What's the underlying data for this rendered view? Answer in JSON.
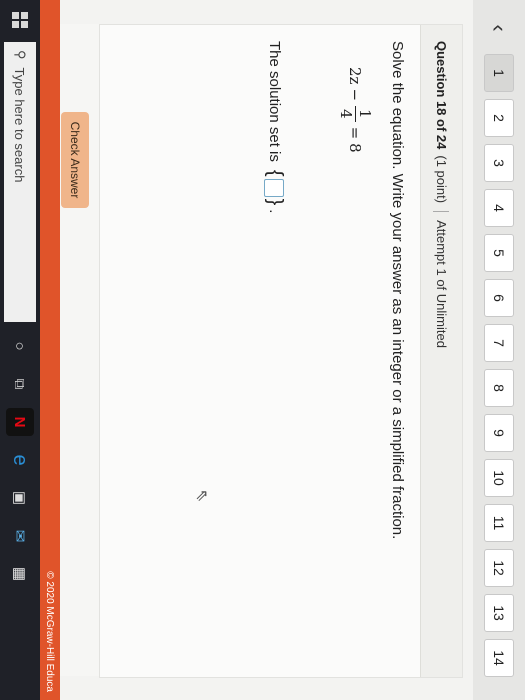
{
  "nav": {
    "back_glyph": "‹",
    "questions": [
      "1",
      "2",
      "3",
      "4",
      "5",
      "6",
      "7",
      "8",
      "9",
      "10",
      "11",
      "12",
      "13",
      "14"
    ],
    "active_index": 0
  },
  "question": {
    "title": "Question 18 of 24",
    "points": "(1 point)",
    "attempt": "Attempt 1 of Unlimited",
    "instructions": "Solve the equation. Write your answer as an integer or a simplified fraction.",
    "equation": {
      "left": "2z",
      "minus": "−",
      "numerator": "1",
      "denominator": "4",
      "equals": "=",
      "right": "8"
    },
    "answer_prefix": "The solution set is",
    "brace_open": "{",
    "brace_close": "}",
    "period": "."
  },
  "actions": {
    "check_label": "Check Answer"
  },
  "footer": {
    "copyright": "© 2020 McGraw-Hill Educa"
  },
  "taskbar": {
    "search_placeholder": "Type here to search",
    "icons": [
      "windows-icon",
      "search-icon",
      "cortana-icon",
      "task-view-icon",
      "netflix-icon",
      "edge-icon",
      "store-icon",
      "mail-icon",
      "photos-icon"
    ]
  },
  "colors": {
    "accent": "#e0542a",
    "check_button": "#f0b58a",
    "answer_border": "#76a9c7"
  }
}
